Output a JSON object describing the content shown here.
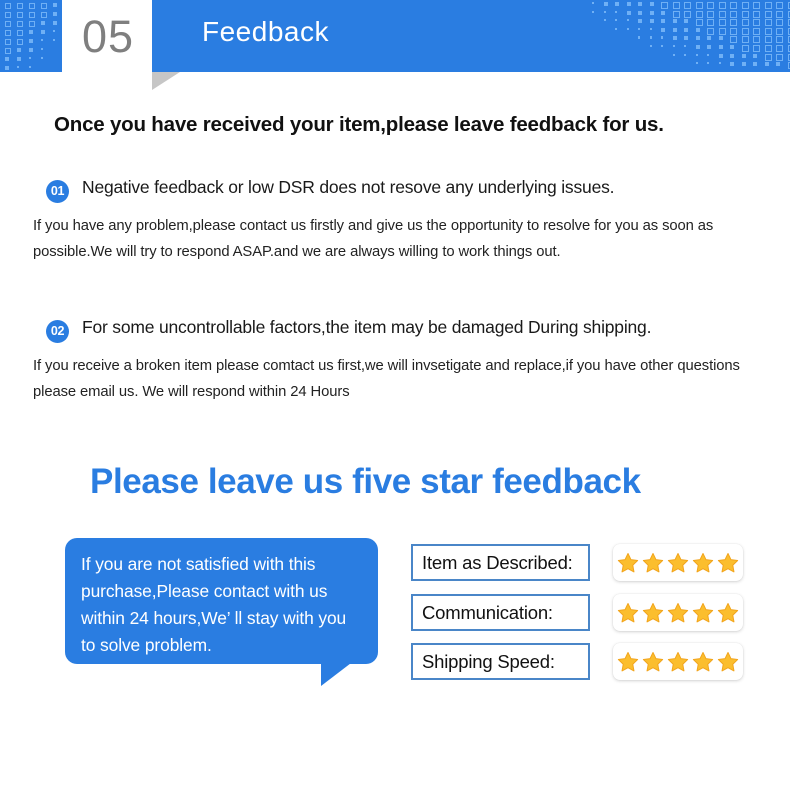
{
  "header": {
    "number": "05",
    "title": "Feedback",
    "accent_color": "#2a7de1",
    "pattern_color": "#6fb0f5",
    "fold_color": "#c6c6c6",
    "number_color": "#7f7f7f"
  },
  "headline": "Once you have received your item,please leave feedback for us.",
  "items": [
    {
      "badge": "01",
      "title": "Negative feedback or low DSR does not resove any underlying issues.",
      "body": "If you have any problem,please contact us firstly and give us the opportunity to resolve for you as soon as possible.We will try to respond ASAP.and we are always willing to work  things out."
    },
    {
      "badge": "02",
      "title": "For some uncontrollable factors,the item may be damaged During shipping.",
      "body": "If you receive a broken item please comtact us first,we will invsetigate and replace,if you have other questions please email us. We will respond within 24 Hours"
    }
  ],
  "big_heading": {
    "text": "Please leave us five star feedback",
    "color": "#2a7de1"
  },
  "bubble": {
    "text": "If you are not satisfied with this purchase,Please  contact with us  within 24 hours,We’ ll stay with you to solve problem.",
    "background": "#2a7de1",
    "text_color": "#ffffff"
  },
  "ratings": {
    "border_color": "#4a86c8",
    "star_color": "#fbbe2e",
    "star_count": 5,
    "rows": [
      {
        "label": "Item as Described:",
        "stars": 5
      },
      {
        "label": "Communication:",
        "stars": 5
      },
      {
        "label": "Shipping  Speed:",
        "stars": 5
      }
    ]
  }
}
